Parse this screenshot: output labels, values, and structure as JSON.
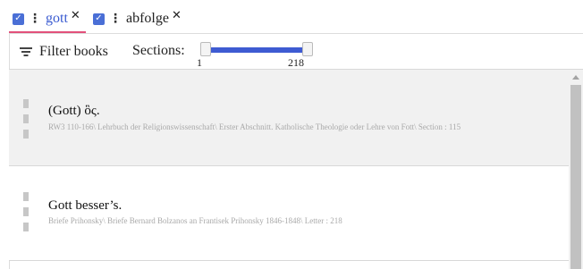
{
  "tabs": [
    {
      "label": "gott",
      "checked": true,
      "active": true,
      "close_icon": "close-icon",
      "check_icon": "checkbox-icon",
      "menu_icon": "kebab-icon"
    },
    {
      "label": "abfolge",
      "checked": true,
      "active": false,
      "close_icon": "close-icon",
      "check_icon": "checkbox-icon",
      "menu_icon": "kebab-icon"
    }
  ],
  "filter": {
    "label": "Filter books",
    "icon": "filter-icon"
  },
  "sections": {
    "label": "Sections:",
    "min": "1",
    "max": "218",
    "range_start": 1,
    "range_end": 218
  },
  "results": [
    {
      "title": "(Gott) ὃς.",
      "meta": "RW3 110-166\\ Lehrbuch der Religionswissenschaft\\ Erster Abschnitt. Katholische Theologie oder Lehre von Fott\\ Section : 115"
    },
    {
      "title": "Gott besser’s.",
      "meta": "Briefe Prihonsky\\ Briefe Bernard Bolzanos an Frantisek Prihonsky 1846-1848\\ Letter : 218"
    }
  ],
  "colors": {
    "accent": "#3e5bd2",
    "tab_underline": "#e2507a",
    "selected_row": "#f1f1f1"
  }
}
